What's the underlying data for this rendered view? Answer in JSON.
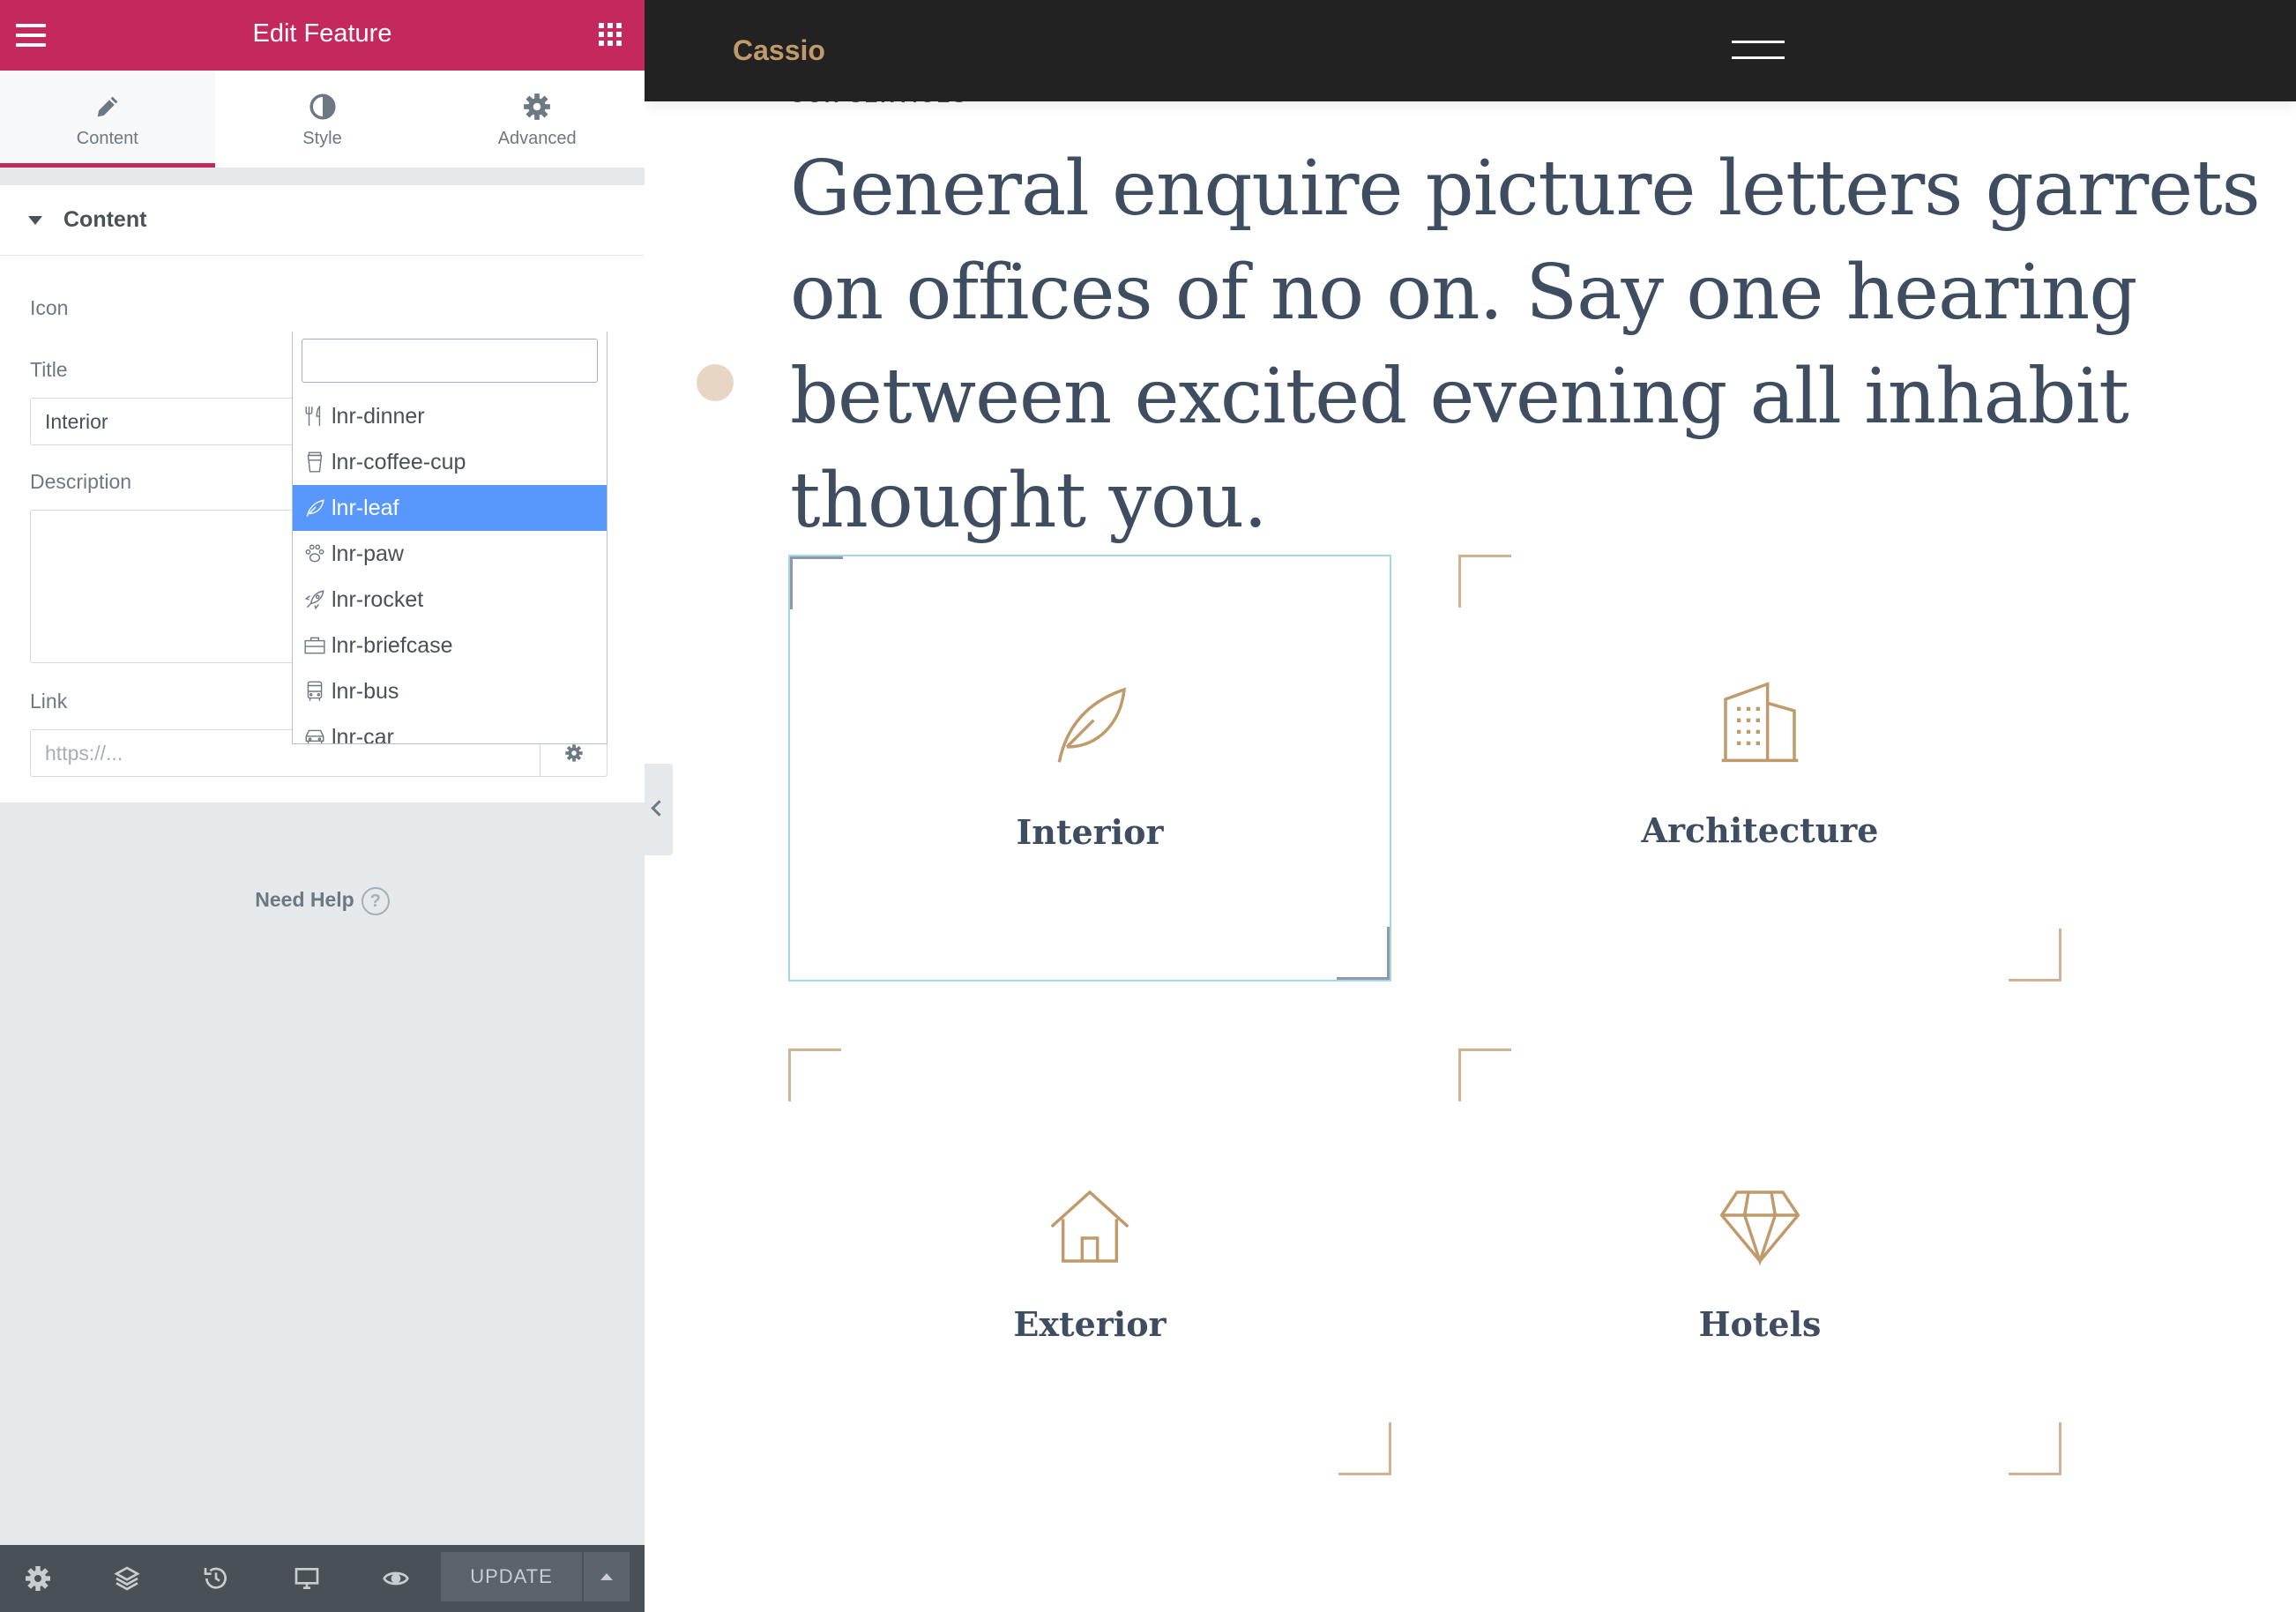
{
  "editor": {
    "header": {
      "title": "Edit Feature"
    },
    "tabs": [
      {
        "label": "Content",
        "icon": "pencil-icon",
        "active": true
      },
      {
        "label": "Style",
        "icon": "contrast-icon",
        "active": false
      },
      {
        "label": "Advanced",
        "icon": "gear-icon",
        "active": false
      }
    ],
    "section": {
      "title": "Content"
    },
    "controls": {
      "icon_label": "Icon",
      "icon_value": "lnr-leaf",
      "clear_symbol": "×",
      "title_label": "Title",
      "title_value": "Interior",
      "description_label": "Description",
      "description_value": "",
      "link_label": "Link",
      "link_placeholder": "https://..."
    },
    "icon_dropdown": {
      "search_value": "",
      "options": [
        {
          "label": "lnr-dinner",
          "icon": "dinner-icon"
        },
        {
          "label": "lnr-coffee-cup",
          "icon": "coffee-cup-icon"
        },
        {
          "label": "lnr-leaf",
          "icon": "leaf-icon",
          "selected": true
        },
        {
          "label": "lnr-paw",
          "icon": "paw-icon"
        },
        {
          "label": "lnr-rocket",
          "icon": "rocket-icon"
        },
        {
          "label": "lnr-briefcase",
          "icon": "briefcase-icon"
        },
        {
          "label": "lnr-bus",
          "icon": "bus-icon"
        },
        {
          "label": "lnr-car",
          "icon": "car-icon"
        }
      ]
    },
    "need_help": {
      "label": "Need Help",
      "icon_glyph": "?"
    },
    "footer": {
      "icons": [
        "settings-icon",
        "layers-icon",
        "history-icon",
        "responsive-icon",
        "preview-icon"
      ],
      "update_label": "UPDATE"
    },
    "accent_color": "#c5285c",
    "selected_option_color": "#5897fb"
  },
  "site": {
    "logo": "Cassio",
    "kicker": "OUR SERVICES",
    "headline": "General enquire picture letters garrets on offices of no on. Say one hearing between excited evening all inhabit thought you.",
    "features": [
      {
        "title": "Interior",
        "icon": "leaf-icon",
        "active": true
      },
      {
        "title": "Architecture",
        "icon": "building-icon",
        "active": false
      },
      {
        "title": "Exterior",
        "icon": "home-icon",
        "active": false
      },
      {
        "title": "Hotels",
        "icon": "diamond-icon",
        "active": false
      }
    ],
    "colors": {
      "header_bg": "#222222",
      "accent": "#c09a6b",
      "heading": "#3f4d61"
    }
  }
}
